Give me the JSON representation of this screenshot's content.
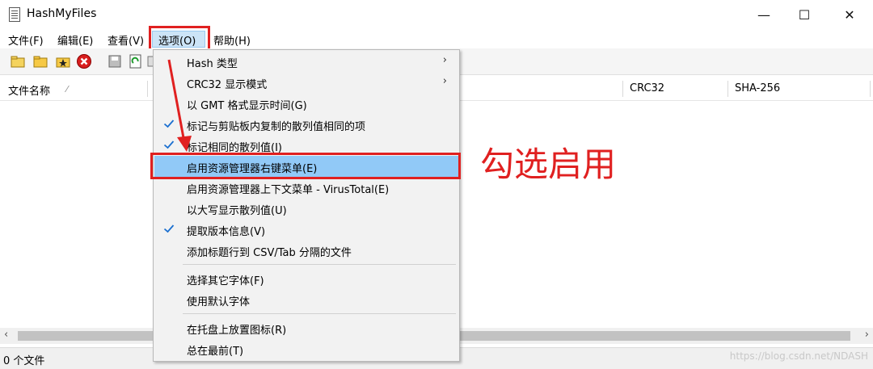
{
  "window": {
    "title": "HashMyFiles",
    "minimize": "—",
    "maximize": "☐",
    "close": "✕"
  },
  "menubar": [
    "文件(F)",
    "编辑(E)",
    "查看(V)",
    "选项(O)",
    "帮助(H)"
  ],
  "columns": {
    "name": "文件名称",
    "sort": "⁄",
    "crc32": "CRC32",
    "sha256": "SHA-256"
  },
  "status": {
    "files": "0 个文件"
  },
  "dropdown": {
    "items": [
      {
        "label": "Hash 类型",
        "submenu": true,
        "checked": false
      },
      {
        "label": "CRC32 显示模式",
        "submenu": true,
        "checked": false
      },
      {
        "label": "以 GMT 格式显示时间(G)",
        "submenu": false,
        "checked": false
      },
      {
        "label": "标记与剪贴板内复制的散列值相同的项",
        "submenu": false,
        "checked": true
      },
      {
        "label": "标记相同的散列值(I)",
        "submenu": false,
        "checked": true
      },
      {
        "label": "启用资源管理器右键菜单(E)",
        "submenu": false,
        "checked": false,
        "highlighted": true
      },
      {
        "label": "启用资源管理器上下文菜单 - VirusTotal(E)",
        "submenu": false,
        "checked": false
      },
      {
        "label": "以大写显示散列值(U)",
        "submenu": false,
        "checked": false
      },
      {
        "label": "提取版本信息(V)",
        "submenu": false,
        "checked": true
      },
      {
        "label": "添加标题行到 CSV/Tab 分隔的文件",
        "submenu": false,
        "checked": false
      },
      {
        "label": "选择其它字体(F)",
        "submenu": false,
        "checked": false
      },
      {
        "label": "使用默认字体",
        "submenu": false,
        "checked": false
      },
      {
        "label": "在托盘上放置图标(R)",
        "submenu": false,
        "checked": false
      },
      {
        "label": "总在最前(T)",
        "submenu": false,
        "checked": false
      }
    ],
    "submenu_arrow": "›"
  },
  "annotation": "勾选启用",
  "watermark": "https://blog.csdn.net/NDASH",
  "colors": {
    "accent_red": "#e02020",
    "highlight_blue": "#91c9f7",
    "check_blue": "#1a6fd0"
  }
}
